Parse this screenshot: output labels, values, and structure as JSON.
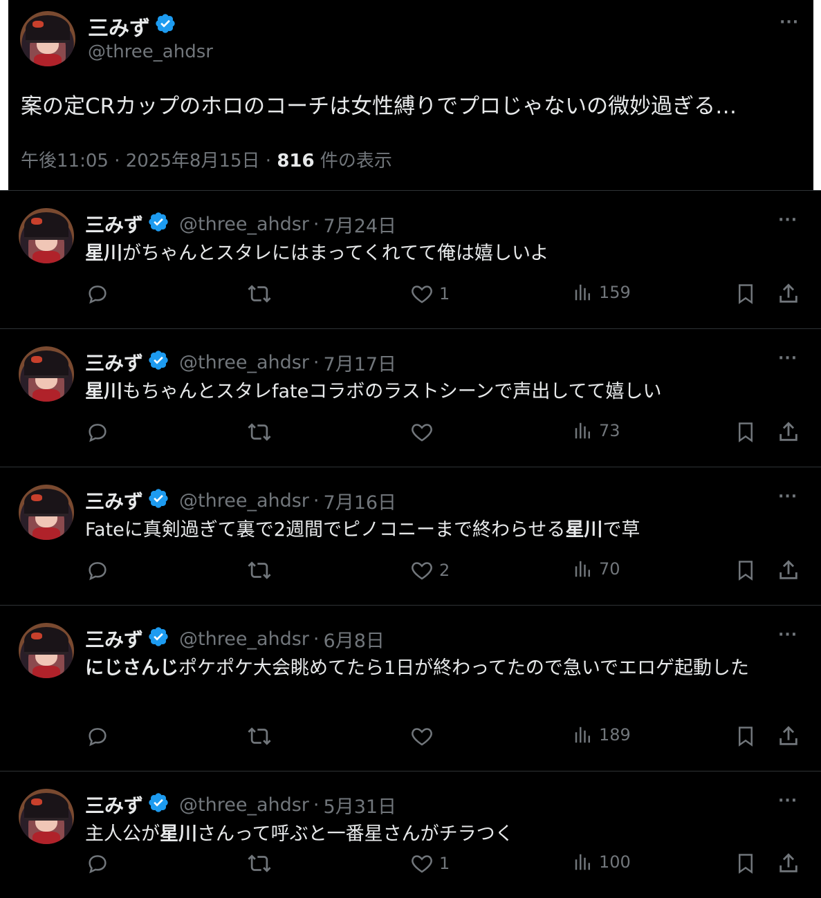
{
  "main": {
    "display_name": "三みず",
    "handle": "@three_ahdsr",
    "text": "案の定CRカップのホロのコーチは女性縛りでプロじゃないの微妙過ぎる…",
    "time": "午後11:05",
    "date": "2025年8月15日",
    "views_count": "816",
    "views_label": "件の表示",
    "more": "···"
  },
  "tweets": [
    {
      "display_name": "三みず",
      "handle": "@three_ahdsr",
      "date": "7月24日",
      "text_bold": "星川",
      "text_rest": "がちゃんとスタレにはまってくれてて俺は嬉しいよ",
      "likes": "1",
      "views": "159"
    },
    {
      "display_name": "三みず",
      "handle": "@three_ahdsr",
      "date": "7月17日",
      "text_bold": "星川",
      "text_rest": "もちゃんとスタレfateコラボのラストシーンで声出してて嬉しい",
      "likes": "",
      "views": "73"
    },
    {
      "display_name": "三みず",
      "handle": "@three_ahdsr",
      "date": "7月16日",
      "text_pre": "Fateに真剣過ぎて裏で2週間でピノコニーまで終わらせる",
      "text_bold": "星川",
      "text_rest": "で草",
      "likes": "2",
      "views": "70"
    },
    {
      "display_name": "三みず",
      "handle": "@three_ahdsr",
      "date": "6月8日",
      "text_bold": "にじさんじ",
      "text_rest": "ポケポケ大会眺めてたら1日が終わってたので急いでエロゲ起動した",
      "likes": "",
      "views": "189"
    },
    {
      "display_name": "三みず",
      "handle": "@three_ahdsr",
      "date": "5月31日",
      "text_pre": "主人公が",
      "text_bold": "星川",
      "text_rest": "さんって呼ぶと一番星さんがチラつく",
      "likes": "1",
      "views": "100"
    }
  ],
  "colors": {
    "background": "#000000",
    "text": "#e7e9ea",
    "muted": "#71767b",
    "verified": "#1d9bf0",
    "divider": "#2f3336"
  }
}
